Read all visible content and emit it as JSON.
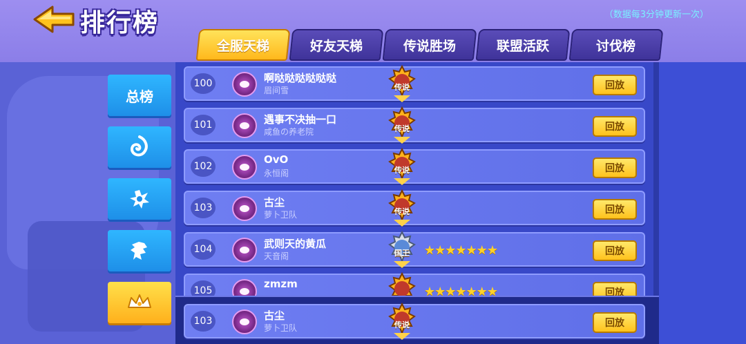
{
  "header": {
    "title": "排行榜",
    "refresh_note": "（数据每3分钟更新一次）"
  },
  "tabs": [
    {
      "label": "全服天梯",
      "active": true
    },
    {
      "label": "好友天梯",
      "active": false
    },
    {
      "label": "传说胜场",
      "active": false
    },
    {
      "label": "联盟活跃",
      "active": false
    },
    {
      "label": "讨伐榜",
      "active": false
    }
  ],
  "side_nav": [
    {
      "label": "总榜",
      "icon": "",
      "active": false
    },
    {
      "label": "",
      "icon": "swirl-emblem-icon",
      "active": false
    },
    {
      "label": "",
      "icon": "claw-emblem-icon",
      "active": false
    },
    {
      "label": "",
      "icon": "dragon-emblem-icon",
      "active": false
    },
    {
      "label": "",
      "icon": "crown-emblem-icon",
      "active": true
    }
  ],
  "rows": [
    {
      "rank": "100",
      "name": "啊哒哒哒哒哒哒",
      "guild": "眉间雪",
      "badge": "传说",
      "stars": ""
    },
    {
      "rank": "101",
      "name": "遇事不决抽一口",
      "guild": "咸鱼の养老院",
      "badge": "传说",
      "stars": ""
    },
    {
      "rank": "102",
      "name": "OvO",
      "guild": "永恒阁",
      "badge": "传说",
      "stars": ""
    },
    {
      "rank": "103",
      "name": "古尘",
      "guild": "萝卜卫队",
      "badge": "传说",
      "stars": ""
    },
    {
      "rank": "104",
      "name": "武则天的黄瓜",
      "guild": "天音阁",
      "badge": "国王",
      "stars": "★★★★★★★"
    },
    {
      "rank": "105",
      "name": "zmzm",
      "guild": "",
      "badge": "",
      "stars": "★★★★★★★"
    }
  ],
  "self_row": {
    "rank": "103",
    "name": "古尘",
    "guild": "萝卜卫队",
    "badge": "传说"
  },
  "replay_label": "回放",
  "colors": {
    "accent": "#ffc21c",
    "panel": "#3848c8",
    "row": "#6f7ef2"
  }
}
